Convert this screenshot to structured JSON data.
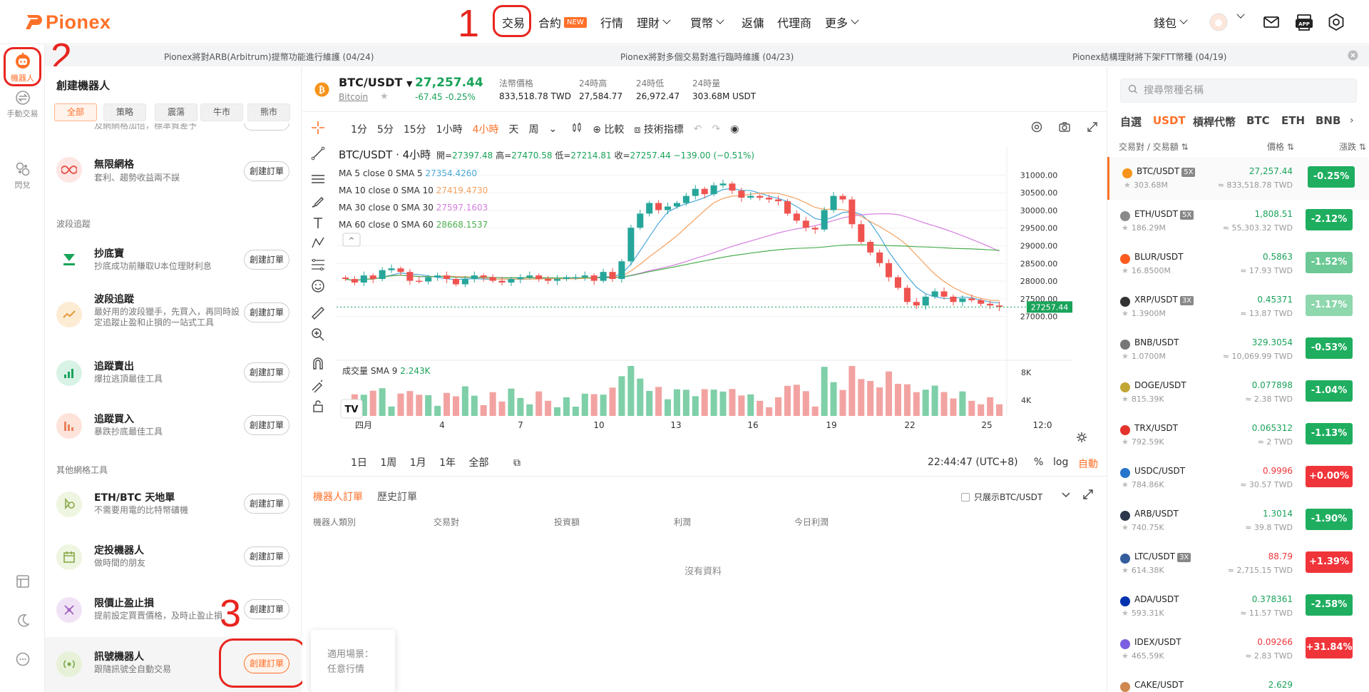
{
  "brand": {
    "name": "Pionex",
    "color": "#ff7028"
  },
  "nav": {
    "trade": "交易",
    "contract": "合約",
    "new_badge": "NEW",
    "market": "行情",
    "finance": "理財",
    "buy": "買幣",
    "rebate": "返傭",
    "agent": "代理商",
    "more": "更多",
    "wallet": "錢包"
  },
  "annotations": {
    "n1": "1",
    "n2": "2",
    "n3": "3"
  },
  "announcements": [
    "Pionex將對ARB(Arbitrum)提幣功能進行維護 (04/24)",
    "Pionex將對多個交易對進行臨時維護 (04/23)",
    "Pionex結構理財將下架FTT幣種 (04/19)"
  ],
  "left_sidebar": {
    "bots": "機器人",
    "manual": "手動交易",
    "flash": "閃兌"
  },
  "bot_panel": {
    "title": "創建機器人",
    "filters": [
      "全部",
      "策略",
      "震蕩",
      "牛市",
      "熊市"
    ],
    "cut_text": "及網網格加倍，標準資差予",
    "create_label": "創建訂單",
    "sections": {
      "wave": "波段追蹤",
      "other": "其他網格工具"
    },
    "items": [
      {
        "name": "無限網格",
        "desc": "套利、趨勢收益兩不誤"
      },
      {
        "name": "抄底寶",
        "desc": "抄底成功前賺取U本位理財利息"
      },
      {
        "name": "波段追蹤",
        "desc": "最好用的波段獵手，先買入，再同時設定追蹤止盈和止損的一站式工具"
      },
      {
        "name": "追蹤賣出",
        "desc": "爆拉逃頂最佳工具"
      },
      {
        "name": "追蹤買入",
        "desc": "暴跌抄底最佳工具"
      },
      {
        "name": "ETH/BTC 天地單",
        "desc": "不需要用電的比特幣礦機"
      },
      {
        "name": "定投機器人",
        "desc": "做時間的朋友"
      },
      {
        "name": "限價止盈止損",
        "desc": "提前設定買賣價格，及時止盈止損"
      },
      {
        "name": "訊號機器人",
        "desc": "跟隨訊號全自動交易"
      }
    ]
  },
  "tooltip": {
    "line1": "適用場景：",
    "line2": "任意行情"
  },
  "symbol": {
    "pair": "BTC/USDT",
    "name": "Bitcoin",
    "price": "27,257.44",
    "change": "-67.45 -0.25%",
    "fiat_label": "法幣價格",
    "fiat_value": "833,518.78 TWD",
    "high_label": "24時高",
    "high_value": "27,584.77",
    "low_label": "24時低",
    "low_value": "26,972.47",
    "vol_label": "24時量",
    "vol_value": "303.68M USDT"
  },
  "toolbar": {
    "intervals": [
      "1分",
      "5分",
      "15分",
      "1小時",
      "4小時",
      "天",
      "周"
    ],
    "compare": "比較",
    "indicators": "技術指標"
  },
  "chart_legend": {
    "title": "BTC/USDT · 4小時",
    "ohlc_open_lbl": "開=",
    "ohlc_open": "27397.48",
    "ohlc_high_lbl": "高=",
    "ohlc_high": "27470.58",
    "ohlc_low_lbl": "低=",
    "ohlc_low": "27214.81",
    "ohlc_close_lbl": "收=",
    "ohlc_close": "27257.44",
    "ohlc_change": "−139.00 (−0.51%)",
    "ma": [
      {
        "label": "MA 5 close 0 SMA 5",
        "value": "27354.4260",
        "color": "#4aa8d8"
      },
      {
        "label": "MA 10 close 0 SMA 10",
        "value": "27419.4730",
        "color": "#f4a261"
      },
      {
        "label": "MA 30 close 0 SMA 30",
        "value": "27597.1603",
        "color": "#d67fe0"
      },
      {
        "label": "MA 60 close 0 SMA 60",
        "value": "28668.1537",
        "color": "#4caf50"
      }
    ],
    "volume_label": "成交量 SMA 9",
    "volume_value": "2.243K"
  },
  "chart_data": {
    "type": "candlestick",
    "y_ticks": [
      "31000.00",
      "30500.00",
      "30000.00",
      "29500.00",
      "29000.00",
      "28500.00",
      "28000.00",
      "27500.00",
      "27000.00"
    ],
    "ylim": [
      26800,
      31200
    ],
    "last_price_label": "27257.44",
    "vol_ticks": [
      "8K",
      "4K"
    ],
    "x_ticks": [
      "四月",
      "4",
      "7",
      "10",
      "13",
      "16",
      "19",
      "22",
      "25",
      "12:0"
    ],
    "close_series": [
      28050,
      27950,
      28150,
      28050,
      28300,
      28350,
      28250,
      28000,
      27980,
      28100,
      28150,
      28050,
      27900,
      28050,
      28150,
      28100,
      28000,
      27950,
      28050,
      28100,
      28150,
      28050,
      28000,
      28050,
      28100,
      28100,
      28150,
      28000,
      28250,
      28050,
      28550,
      29500,
      29900,
      30200,
      30000,
      30100,
      30200,
      30400,
      30600,
      30450,
      30700,
      30750,
      30550,
      30350,
      30400,
      30350,
      30300,
      30250,
      29900,
      29700,
      29500,
      29450,
      30000,
      30400,
      30300,
      29600,
      29100,
      28800,
      28500,
      28100,
      27800,
      27400,
      27300,
      27550,
      27700,
      27550,
      27400,
      27500,
      27450,
      27350,
      27300,
      27260
    ]
  },
  "chart_footer": {
    "ranges": [
      "1日",
      "1周",
      "1月",
      "1年",
      "全部"
    ],
    "time": "22:44:47 (UTC+8)",
    "pct": "%",
    "log": "log",
    "auto": "自動"
  },
  "orders": {
    "tab_bots": "機器人訂單",
    "tab_history": "歷史訂單",
    "only_show": "只展示BTC/USDT",
    "columns": [
      "機器人類別",
      "交易對",
      "投資額",
      "利潤",
      "今日利潤"
    ],
    "empty": "沒有資料"
  },
  "market": {
    "search_placeholder": "搜尋幣種名稱",
    "tabs": [
      "自選",
      "USDT",
      "槓桿代幣",
      "BTC",
      "ETH",
      "BNB"
    ],
    "hdr_pair": "交易對 / 交易額",
    "hdr_price": "價格",
    "hdr_change": "漲跌",
    "rows": [
      {
        "pair": "BTC/USDT",
        "lev": "5X",
        "vol": "303.68M",
        "price": "27,257.44",
        "twd": "≈ 833,518.78 TWD",
        "chg": "-0.25%",
        "dir": "up",
        "bg": "bg-dn-strong",
        "coin": "#f7931a"
      },
      {
        "pair": "ETH/USDT",
        "lev": "5X",
        "vol": "186.29M",
        "price": "1,808.51",
        "twd": "≈ 55,303.32 TWD",
        "chg": "-2.12%",
        "dir": "up",
        "bg": "bg-dn-strong",
        "coin": "#8a8a8a"
      },
      {
        "pair": "BLUR/USDT",
        "lev": "",
        "vol": "16.8500M",
        "price": "0.5863",
        "twd": "≈ 17.93 TWD",
        "chg": "-1.52%",
        "dir": "up",
        "bg": "bg-dn-weak",
        "coin": "#ff5b1f"
      },
      {
        "pair": "XRP/USDT",
        "lev": "3X",
        "vol": "1.3900M",
        "price": "0.45371",
        "twd": "≈ 13.87 TWD",
        "chg": "-1.17%",
        "dir": "up",
        "bg": "bg-dn-faint",
        "coin": "#333333"
      },
      {
        "pair": "BNB/USDT",
        "lev": "",
        "vol": "1.0700M",
        "price": "329.3054",
        "twd": "≈ 10,069.99 TWD",
        "chg": "-0.53%",
        "dir": "up",
        "bg": "bg-dn-strong",
        "coin": "#777777"
      },
      {
        "pair": "DOGE/USDT",
        "lev": "",
        "vol": "815.39K",
        "price": "0.077898",
        "twd": "≈ 2.38 TWD",
        "chg": "-1.04%",
        "dir": "up",
        "bg": "bg-dn-strong",
        "coin": "#c2a633"
      },
      {
        "pair": "TRX/USDT",
        "lev": "",
        "vol": "792.59K",
        "price": "0.065312",
        "twd": "≈ 2 TWD",
        "chg": "-1.13%",
        "dir": "up",
        "bg": "bg-dn-strong",
        "coin": "#e5322d"
      },
      {
        "pair": "USDC/USDT",
        "lev": "",
        "vol": "784.86K",
        "price": "0.9996",
        "twd": "≈ 30.57 TWD",
        "chg": "+0.00%",
        "dir": "dn",
        "bg": "bg-up",
        "coin": "#2775ca"
      },
      {
        "pair": "ARB/USDT",
        "lev": "",
        "vol": "740.75K",
        "price": "1.3014",
        "twd": "≈ 39.8 TWD",
        "chg": "-1.90%",
        "dir": "up",
        "bg": "bg-dn-strong",
        "coin": "#2d374b"
      },
      {
        "pair": "LTC/USDT",
        "lev": "3X",
        "vol": "614.38K",
        "price": "88.79",
        "twd": "≈ 2,715.15 TWD",
        "chg": "+1.39%",
        "dir": "dn",
        "bg": "bg-up",
        "coin": "#345d9d"
      },
      {
        "pair": "ADA/USDT",
        "lev": "",
        "vol": "593.31K",
        "price": "0.378361",
        "twd": "≈ 11.57 TWD",
        "chg": "-2.58%",
        "dir": "up",
        "bg": "bg-dn-strong",
        "coin": "#0033ad"
      },
      {
        "pair": "IDEX/USDT",
        "lev": "",
        "vol": "465.59K",
        "price": "0.09266",
        "twd": "≈ 2.83 TWD",
        "chg": "+31.84%",
        "dir": "dn",
        "bg": "bg-up",
        "coin": "#7b5fe0"
      },
      {
        "pair": "CAKE/USDT",
        "lev": "",
        "vol": "",
        "price": "2.629",
        "twd": "",
        "chg": "",
        "dir": "up",
        "bg": "bg-dn-strong",
        "coin": "#d1884f"
      }
    ]
  }
}
